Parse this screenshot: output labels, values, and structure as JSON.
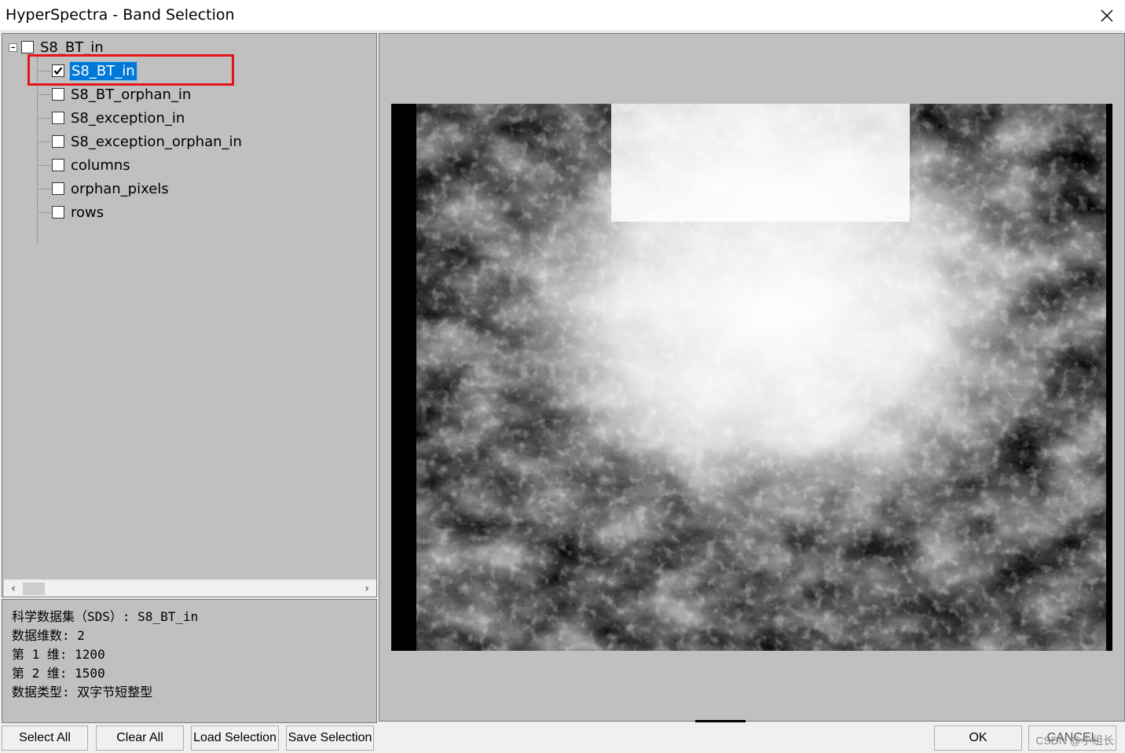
{
  "window": {
    "title": "HyperSpectra - Band Selection"
  },
  "tree": {
    "root": {
      "label": "S8_BT_in",
      "checked": false
    },
    "items": [
      {
        "label": "S8_BT_in",
        "checked": true,
        "selected": true
      },
      {
        "label": "S8_BT_orphan_in",
        "checked": false
      },
      {
        "label": "S8_exception_in",
        "checked": false
      },
      {
        "label": "S8_exception_orphan_in",
        "checked": false
      },
      {
        "label": "columns",
        "checked": false
      },
      {
        "label": "orphan_pixels",
        "checked": false
      },
      {
        "label": "rows",
        "checked": false
      }
    ]
  },
  "info": {
    "lines": [
      "科学数据集（SDS）: S8_BT_in",
      "数据维数: 2",
      "第 1 维: 1200",
      "第 2 维: 1500",
      "数据类型: 双字节短整型"
    ]
  },
  "buttons": {
    "select_all": "Select All",
    "clear_all": "Clear All",
    "load_selection": "Load Selection",
    "save_selection": "Save Selection",
    "ok": "OK",
    "cancel": "CANCEL"
  },
  "watermark": "CSDN @小组长",
  "colors": {
    "selection": "#0078d7",
    "highlight_box": "#e4141c",
    "panel": "#c0c0c0"
  }
}
